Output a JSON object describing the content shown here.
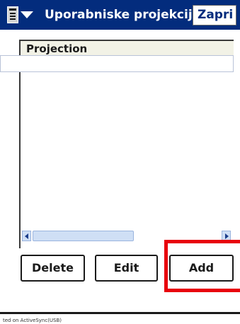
{
  "titlebar": {
    "menu_icon": "document-menu-icon",
    "dropdown_icon": "dropdown-arrow-icon",
    "title": "Uporabniske projekcije",
    "close_label": "Zapri",
    "background_color": "#032c7d"
  },
  "list": {
    "header_label": "Projection",
    "rows": []
  },
  "scrollbar": {
    "left_icon": "scroll-left-icon",
    "right_icon": "scroll-right-icon"
  },
  "actions": {
    "delete_label": "Delete",
    "edit_label": "Edit",
    "add_label": "Add",
    "highlight_color": "#e8000c"
  },
  "status": {
    "text": "ted on ActiveSync(USB)"
  }
}
